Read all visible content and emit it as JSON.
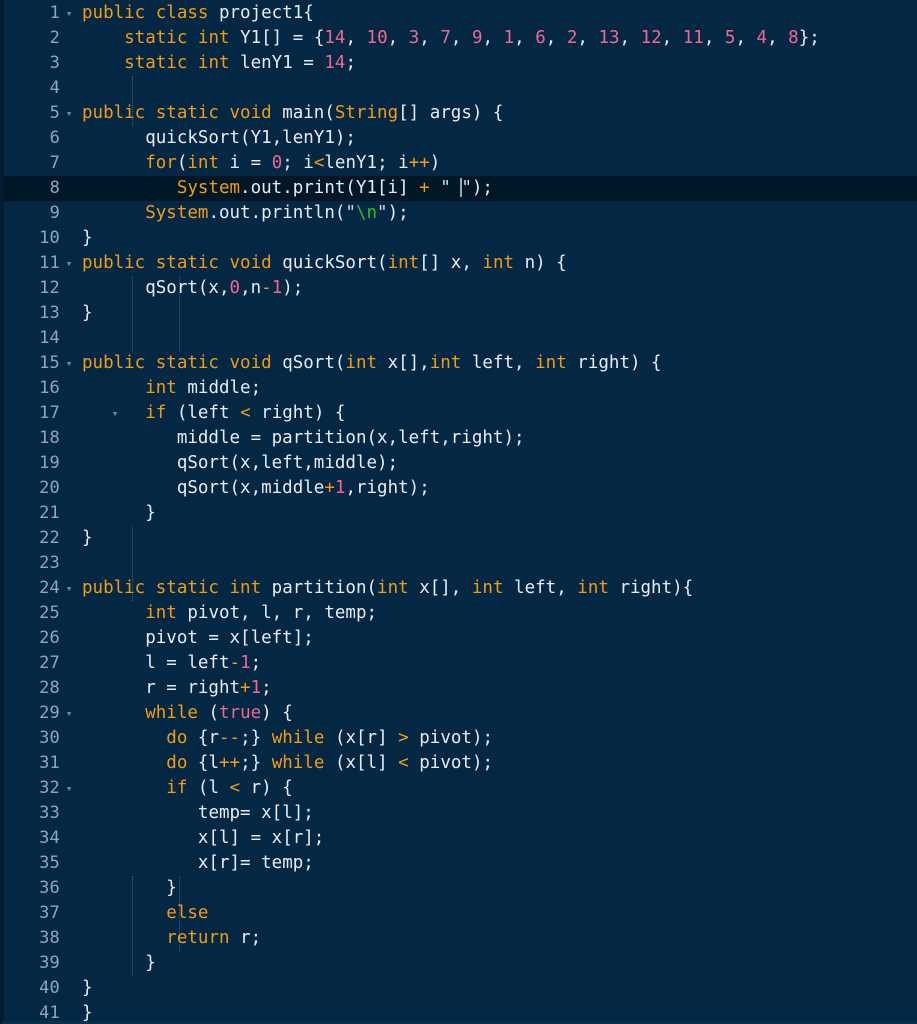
{
  "editor": {
    "language": "java",
    "theme": "dark-navy",
    "current_line": 8,
    "total_lines": 41,
    "colors": {
      "background": "#042744",
      "current_line_background": "#001728",
      "gutter_text": "#8fa7bb",
      "keyword": "#f39c12",
      "number": "#f2678f",
      "identifier": "#e8ecef",
      "string": "#d7dde2",
      "escape": "#25c025",
      "indent_guide": "#40617d"
    },
    "fold_markers": [
      1,
      5,
      11,
      15,
      17,
      24,
      29,
      32
    ],
    "fold_glyph": "▾"
  },
  "gutter": {
    "numbers": [
      "1",
      "2",
      "3",
      "4",
      "5",
      "6",
      "7",
      "8",
      "9",
      "10",
      "11",
      "12",
      "13",
      "14",
      "15",
      "16",
      "17",
      "18",
      "19",
      "20",
      "21",
      "22",
      "23",
      "24",
      "25",
      "26",
      "27",
      "28",
      "29",
      "30",
      "31",
      "32",
      "33",
      "34",
      "35",
      "36",
      "37",
      "38",
      "39",
      "40",
      "41"
    ]
  },
  "code": {
    "lines": [
      "public class project1{",
      "    static int Y1[] = {14, 10, 3, 7, 9, 1, 6, 2, 13, 12, 11, 5, 4, 8};",
      "    static int lenY1 = 14;",
      "",
      "public static void main(String[] args) {",
      "      quickSort(Y1,lenY1);",
      "      for(int i = 0; i<lenY1; i++)",
      "         System.out.print(Y1[i] + \" \");",
      "      System.out.println(\"\\n\");",
      "}",
      "public static void quickSort(int[] x, int n) {",
      "      qSort(x,0,n-1);",
      "}",
      "",
      "public static void qSort(int x[],int left, int right) {",
      "      int middle;",
      "      if (left < right) {",
      "         middle = partition(x,left,right);",
      "         qSort(x,left,middle);",
      "         qSort(x,middle+1,right);",
      "      }",
      "}",
      "",
      "public static int partition(int x[], int left, int right){",
      "      int pivot, l, r, temp;",
      "      pivot = x[left];",
      "      l = left-1;",
      "      r = right+1;",
      "      while (true) {",
      "        do {r--;} while (x[r] > pivot);",
      "        do {l++;} while (x[l] < pivot);",
      "        if (l < r) {",
      "           temp= x[l];",
      "           x[l] = x[r];",
      "           x[r]= temp;",
      "        }",
      "        else",
      "        return r;",
      "      }",
      "}",
      "}"
    ],
    "array_literal": [
      14,
      10,
      3,
      7,
      9,
      1,
      6,
      2,
      13,
      12,
      11,
      5,
      4,
      8
    ],
    "array_length": 14,
    "class_name": "project1",
    "methods": [
      "main",
      "quickSort",
      "qSort",
      "partition"
    ]
  }
}
